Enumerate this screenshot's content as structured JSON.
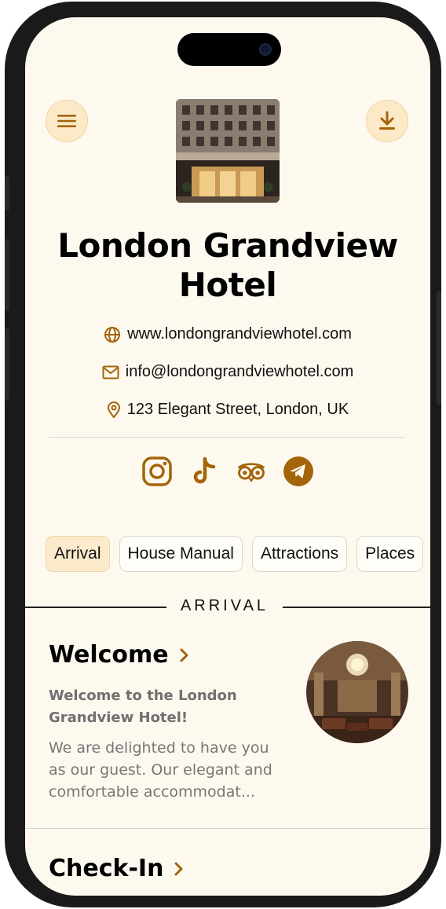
{
  "hotel": {
    "name": "London Grandview Hotel",
    "website": "www.londongrandviewhotel.com",
    "email": "info@londongrandviewhotel.com",
    "address": "123 Elegant Street, London, UK"
  },
  "icons": {
    "menu": "hamburger-menu-icon",
    "download": "download-icon",
    "website": "globe-icon",
    "email": "mail-icon",
    "address": "map-pin-icon"
  },
  "socials": [
    "instagram-icon",
    "tiktok-icon",
    "tripadvisor-icon",
    "telegram-icon"
  ],
  "tabs": [
    {
      "label": "Arrival",
      "active": true
    },
    {
      "label": "House Manual",
      "active": false
    },
    {
      "label": "Attractions",
      "active": false
    },
    {
      "label": "Places",
      "active": false
    }
  ],
  "section": {
    "label": "ARRIVAL"
  },
  "cards": [
    {
      "title": "Welcome",
      "subtitle": "Welcome to the London Grandview Hotel!",
      "body": "We are delighted to have you as our guest. Our elegant and comfortable accommodat..."
    },
    {
      "title": "Check-In"
    }
  ],
  "colors": {
    "background": "#fdf9ef",
    "accent": "#a4640a",
    "accent_light": "#fbe9c8",
    "text": "#000000",
    "muted": "#777777"
  }
}
